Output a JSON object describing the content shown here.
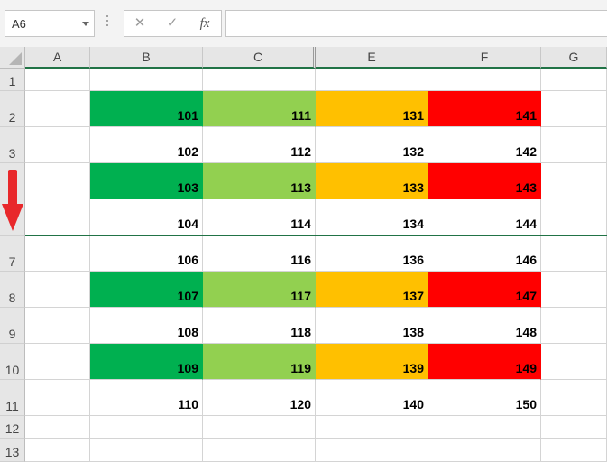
{
  "namebox": {
    "value": "A6"
  },
  "formula_bar": {
    "cancel_icon": "✕",
    "enter_icon": "✓",
    "fx_label": "fx",
    "content": ""
  },
  "columns": [
    "A",
    "B",
    "C",
    "E",
    "F",
    "G"
  ],
  "rows": [
    {
      "label": "1",
      "values": [
        "",
        "",
        "",
        "",
        ""
      ]
    },
    {
      "label": "2",
      "values": [
        "101",
        "111",
        "131",
        "141"
      ],
      "colored": true
    },
    {
      "label": "3",
      "values": [
        "102",
        "112",
        "132",
        "142"
      ]
    },
    {
      "label": "",
      "values": [
        "103",
        "113",
        "133",
        "143"
      ],
      "colored": true
    },
    {
      "label": "",
      "values": [
        "104",
        "114",
        "134",
        "144"
      ]
    },
    {
      "label": "7",
      "values": [
        "106",
        "116",
        "136",
        "146"
      ]
    },
    {
      "label": "8",
      "values": [
        "107",
        "117",
        "137",
        "147"
      ],
      "colored": true
    },
    {
      "label": "9",
      "values": [
        "108",
        "118",
        "138",
        "148"
      ]
    },
    {
      "label": "10",
      "values": [
        "109",
        "119",
        "139",
        "149"
      ],
      "colored": true
    },
    {
      "label": "11",
      "values": [
        "110",
        "120",
        "140",
        "150"
      ]
    },
    {
      "label": "12",
      "values": []
    },
    {
      "label": "13",
      "values": []
    }
  ],
  "fill_colors": [
    "#00b050",
    "#92d050",
    "#ffc000",
    "#ff0000"
  ],
  "arrow_color": "#e8282b"
}
